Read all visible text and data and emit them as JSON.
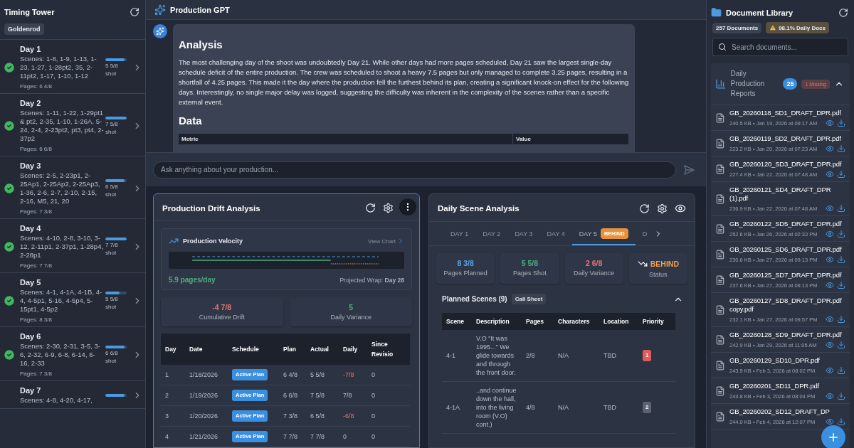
{
  "timing_tower": {
    "title": "Timing Tower",
    "tag": "Goldenrod",
    "days": [
      {
        "title": "Day 1",
        "scenes": "Scenes: 1-8, 1-9, 1-13, 1-23, 1-27, 1-28pt2, 35, 2-11pt2, 1-17, 1-10, 1-12",
        "pages": "Pages: 6 4/8",
        "shot": "5 5/8",
        "shot_label": "shot",
        "level": 0.9,
        "completed": true
      },
      {
        "title": "Day 2",
        "scenes": "Scenes: 1-11, 1-22, 1-29pt1 & pt2, 2-35, 1-10, 1-26A, 5-24, 2-4, 2-23pt2, pt3, pt4, 2-37p2",
        "pages": "Pages: 6 6/8",
        "shot": "7 5/8",
        "shot_label": "shot",
        "level": 1,
        "completed": true
      },
      {
        "title": "Day 3",
        "scenes": "Scenes: 2-5, 2-23p1, 2-25Ap1, 2-25Ap2, 2-25Ap3, 1-36, 2-6, 2-7, 2-10, 2-15, 2-16, M5, 21, 20",
        "pages": "Pages: 7 3/8",
        "shot": "6 5/8",
        "shot_label": "shot",
        "level": 0.9,
        "completed": true
      },
      {
        "title": "Day 4",
        "scenes": "Scenes: 4-10, 2-8, 3-10, 3-12, 2-11p1, 2-37p1, 1-28p4, 2-28p1",
        "pages": "Pages: 7 7/8",
        "shot": "7 7/8",
        "shot_label": "shot",
        "level": 1,
        "completed": true
      },
      {
        "title": "Day 5",
        "scenes": "Scenes: 4-1, 4-1A, 4-1B, 4-4, 4-5p1, 5-16, 4-5p4, 5-15pt1, 4-5p2",
        "pages": "Pages: 8 3/8",
        "shot": "5 5/8",
        "shot_label": "shot",
        "level": 0.67,
        "completed": true
      },
      {
        "title": "Day 6",
        "scenes": "Scenes: 2-30, 2-31, 3-5, 3-6, 2-32, 6-9, 6-8, 6-14, 6-16, 2-33",
        "pages": "Pages: 7 3/8",
        "shot": "6 6/8",
        "shot_label": "shot",
        "level": 0.9,
        "completed": true
      },
      {
        "title": "Day 7",
        "scenes": "Scenes: 4-8, 4-20, 4-17,",
        "level": 0.9
      }
    ]
  },
  "chat": {
    "title": "Production GPT",
    "message": {
      "heading": "Analysis",
      "body": "The most challenging day of the shoot was undoubtedly Day 21. While other days had more pages scheduled, Day 21 saw the largest single-day schedule deficit of the entire production. The crew was scheduled to shoot a heavy 7.5 pages but only managed to complete 3.25 pages, resulting in a shortfall of 4.25 pages. This made it the day where the production fell the furthest behind its plan, creating a significant knock-on effect for the following days. Interestingly, no single major delay was logged, suggesting the difficulty was inherent in the complexity of the scenes rather than a specific external event.",
      "data_heading": "Data",
      "table_columns": [
        "Metric",
        "Value"
      ]
    },
    "input": {
      "placeholder": "Ask anything about your production..."
    }
  },
  "drift_panel": {
    "title": "Production Drift Analysis",
    "velocity": {
      "title": "Production Velocity",
      "link": "View Chart",
      "rate": "5.9 pages/day",
      "projection": "Projected Wrap: **Day 28**"
    },
    "stats": [
      {
        "value": "-4 7/8",
        "label": "Cumulative Drift",
        "color": "#e57373"
      },
      {
        "value": "5",
        "label": "Daily Variance",
        "color": "#4caf7a"
      }
    ],
    "columns": [
      "Day",
      "Date",
      "Schedule",
      "Plan",
      "Actual",
      "Daily",
      "Since Revisio"
    ],
    "rows": [
      {
        "day": "1",
        "date": "1/18/2026",
        "schedule": "Active Plan",
        "plan": "6 4/8",
        "actual": "5 5/8",
        "daily": "-7/8",
        "daily_negative": true,
        "since_revision": "0"
      },
      {
        "day": "2",
        "date": "1/19/2026",
        "schedule": "Active Plan",
        "plan": "6 6/8",
        "actual": "7 5/8",
        "daily": "7/8",
        "daily_negative": false,
        "since_revision": "0"
      },
      {
        "day": "3",
        "date": "1/20/2026",
        "schedule": "Active Plan",
        "plan": "7 3/8",
        "actual": "6 5/8",
        "daily": "-6/8",
        "daily_negative": true,
        "since_revision": "0"
      },
      {
        "day": "4",
        "date": "1/21/2026",
        "schedule": "Active Plan",
        "plan": "7 7/8",
        "actual": "7 7/8",
        "daily": "0",
        "daily_negative": false,
        "since_revision": "0"
      }
    ]
  },
  "scene_panel": {
    "title": "Daily Scene Analysis",
    "tabs": [
      {
        "label": "DAY 1",
        "selected": false
      },
      {
        "label": "DAY 2",
        "selected": false
      },
      {
        "label": "DAY 3",
        "selected": false
      },
      {
        "label": "DAY 4",
        "selected": false
      },
      {
        "label": "DAY 5",
        "selected": true,
        "badge": "BEHIND"
      },
      {
        "label": "D",
        "selected": false
      }
    ],
    "stats": [
      {
        "value": "8 3/8",
        "label": "Pages Planned",
        "color": "#5aa0e6"
      },
      {
        "value": "5 5/8",
        "label": "Pages Shot",
        "color": "#4caf7a"
      },
      {
        "value": "2 6/8",
        "label": "Daily Variance",
        "color": "#e57373"
      },
      {
        "value": "BEHIND",
        "label": "Status",
        "color": "#f0a050",
        "trending_down": true
      }
    ],
    "section": {
      "title": "Planned Scenes (9)",
      "badge": "Call Sheet",
      "expanded": true
    },
    "columns": [
      "Scene",
      "Description",
      "Pages",
      "Characters",
      "Location",
      "Priority"
    ],
    "rows": [
      {
        "scene": "4-1",
        "description": "V.O \"It was 1995...\" We glide towards and through the front door.",
        "pages": "2/8",
        "characters": "N/A",
        "location": "TBD",
        "priority": "1",
        "color": "#e05c5c"
      },
      {
        "scene": "4-1A",
        "description": "..and continue down the hall, into the living room (V.O) cont.)",
        "pages": "4/8",
        "characters": "N/A",
        "location": "TBD",
        "priority": "2",
        "color": "#5b6372"
      }
    ]
  },
  "library": {
    "title": "Document Library",
    "count": "257 Documents",
    "warning": "98.1% Daily Docs",
    "search": {
      "placeholder": "Search documents..."
    },
    "group": {
      "title": "Daily Production Reports",
      "count": "25",
      "missing": "1 Missing",
      "expanded": true
    },
    "documents": [
      {
        "name": "GB_20260118_SD1_DRAFT_DPR.pdf",
        "meta": "240.5 KB • Jan 19, 2026 at 09:17 AM"
      },
      {
        "name": "GB_20260119_SD2_DRAFT_DPR.pdf",
        "meta": "223.2 KB • Jan 20, 2026 at 07:23 AM"
      },
      {
        "name": "GB_20260120_SD3_DRAFT_DPR.pdf",
        "meta": "227.4 KB • Jan 22, 2026 at 07:48 AM"
      },
      {
        "name": "GB_20260121_SD4_DRAFT_DPR (1).pdf",
        "meta": "236.9 KB • Jan 22, 2026 at 07:48 AM"
      },
      {
        "name": "GB_20260122_SD5_DRAFT_DPR.pdf",
        "meta": "252.6 KB • Jan 26, 2026 at 02:33 PM"
      },
      {
        "name": "GB_20260125_SD6_DRAFT_DPR.pdf",
        "meta": "230.6 KB • Jan 27, 2026 at 09:13 PM"
      },
      {
        "name": "GB_20260125_SD7_DRAFT_DPR.pdf",
        "meta": "237.6 KB • Jan 27, 2026 at 09:13 PM"
      },
      {
        "name": "GB_20260127_SD8_DRAFT_DPR.pdf copy.pdf",
        "meta": "232.1 KB • Jan 27, 2026 at 09:57 PM"
      },
      {
        "name": "GB_20260128_SD9_DRAFT_DPR.pdf",
        "meta": "242.9 KB • Jan 29, 2026 at 11:05 AM"
      },
      {
        "name": "GB_20260129_SD10_DPR.pdf",
        "meta": "243.5 KB • Feb 3, 2026 at 08:02 PM"
      },
      {
        "name": "GB_20260201_SD11_DPR.pdf",
        "meta": "243.8 KB • Feb 3, 2026 at 08:04 PM"
      },
      {
        "name": "GB_20260202_SD12_DRAFT_DP",
        "meta": "244.0 KB • Feb 4, 2026 at 12:07 PM"
      }
    ]
  }
}
